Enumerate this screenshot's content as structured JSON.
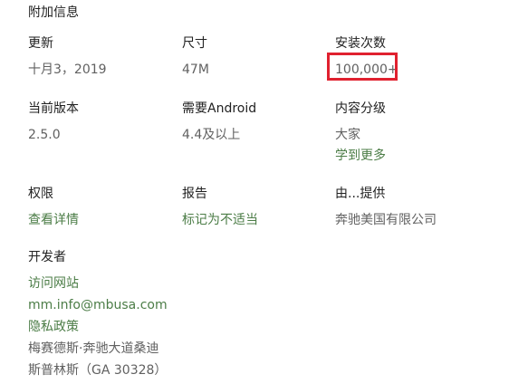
{
  "section": {
    "title": "附加信息"
  },
  "fields": {
    "updated": {
      "label": "更新",
      "value": "十月3，2019"
    },
    "size": {
      "label": "尺寸",
      "value": "47M"
    },
    "installs": {
      "label": "安装次数",
      "value": "100,000+"
    },
    "current_version": {
      "label": "当前版本",
      "value": "2.5.0"
    },
    "requires_android": {
      "label": "需要Android",
      "value": "4.4及以上"
    },
    "content_rating": {
      "label": "内容分级",
      "value": "大家",
      "link": "学到更多"
    },
    "permissions": {
      "label": "权限",
      "link": "查看详情"
    },
    "report": {
      "label": "报告",
      "link": "标记为不适当"
    },
    "offered_by": {
      "label": "由...提供",
      "value": "奔驰美国有限公司"
    }
  },
  "developer": {
    "label": "开发者",
    "website_link": "访问网站",
    "email_link": "mm.info@mbusa.com",
    "privacy_link": "隐私政策",
    "address_line1": "梅赛德斯·奔驰大道桑迪",
    "address_line2": "斯普林斯（GA 30328）"
  },
  "colors": {
    "link": "#4c7d47",
    "highlight": "#e0212f"
  }
}
